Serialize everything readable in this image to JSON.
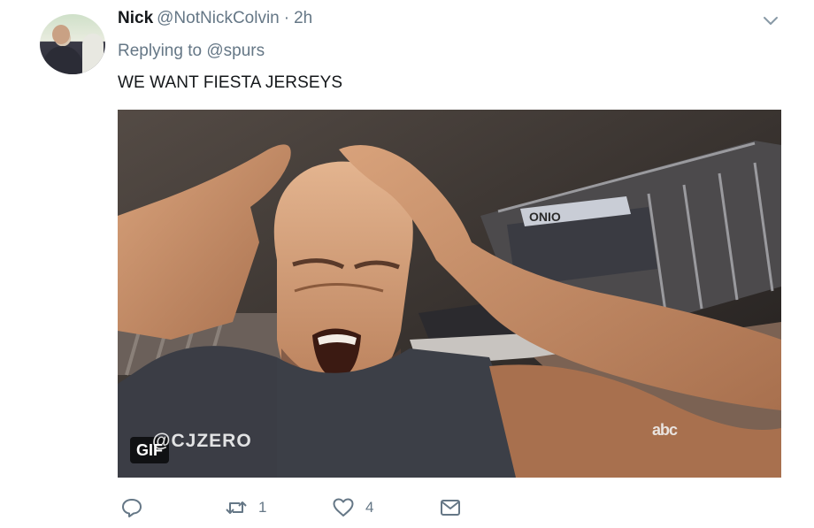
{
  "tweet": {
    "author_name": "Nick",
    "author_handle": "@NotNickColvin",
    "separator": "·",
    "time": "2h",
    "reply_prefix": "Replying to",
    "reply_mention": "@spurs",
    "text": "WE WANT FIESTA JERSEYS"
  },
  "media": {
    "badge": "GIF",
    "watermark": "@CJZERO",
    "network_logo": "abc",
    "arena_sign": "ONIO"
  },
  "actions": {
    "reply_icon": "reply-icon",
    "retweet_icon": "retweet-icon",
    "retweet_count": "1",
    "like_icon": "heart-icon",
    "like_count": "4",
    "message_icon": "envelope-icon"
  },
  "colors": {
    "text": "#14171a",
    "secondary": "#657786"
  }
}
